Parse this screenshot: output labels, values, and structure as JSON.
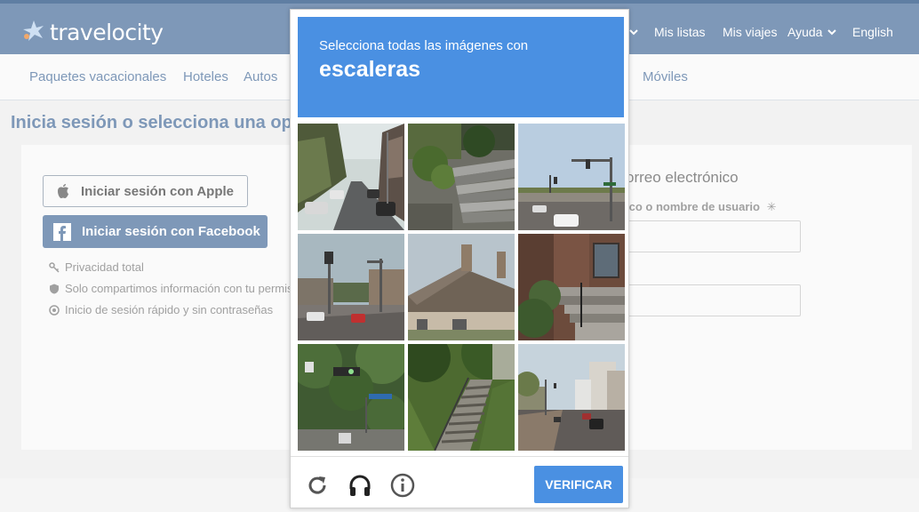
{
  "brand": {
    "logo_text": "travelocity"
  },
  "topnav": {
    "my_lists": "Mis listas",
    "my_trips": "Mis viajes",
    "help": "Ayuda",
    "language": "English"
  },
  "subnav": {
    "items": [
      "Paquetes vacacionales",
      "Hoteles",
      "Autos",
      "Móviles"
    ]
  },
  "page": {
    "heading": "Inicia sesión o selecciona una op",
    "apple_button": "Iniciar sesión con Apple",
    "facebook_button": "Iniciar sesión con Facebook",
    "benefits": [
      "Privacidad total",
      "Solo compartimos información con tu permis",
      "Inicio de sesión rápido y sin contraseñas"
    ],
    "email_heading": "orreo electrónico",
    "email_label": "ico o nombre de usuario",
    "required_marker": "✳"
  },
  "captcha": {
    "prompt": "Selecciona todas las imágenes con",
    "target": "escaleras",
    "verify_button": "VERIFICAR",
    "footer_icons": [
      "reload-icon",
      "audio-headphones-icon",
      "info-icon"
    ],
    "tiles": [
      "street-with-parked-cars",
      "concrete-stairs",
      "intersection-traffic-light",
      "intersection-storefronts",
      "house-roof",
      "brick-house-steps",
      "trees-traffic-signal",
      "outdoor-staircase-grass",
      "city-street-buildings"
    ],
    "accent_color": "#4a90e2"
  }
}
